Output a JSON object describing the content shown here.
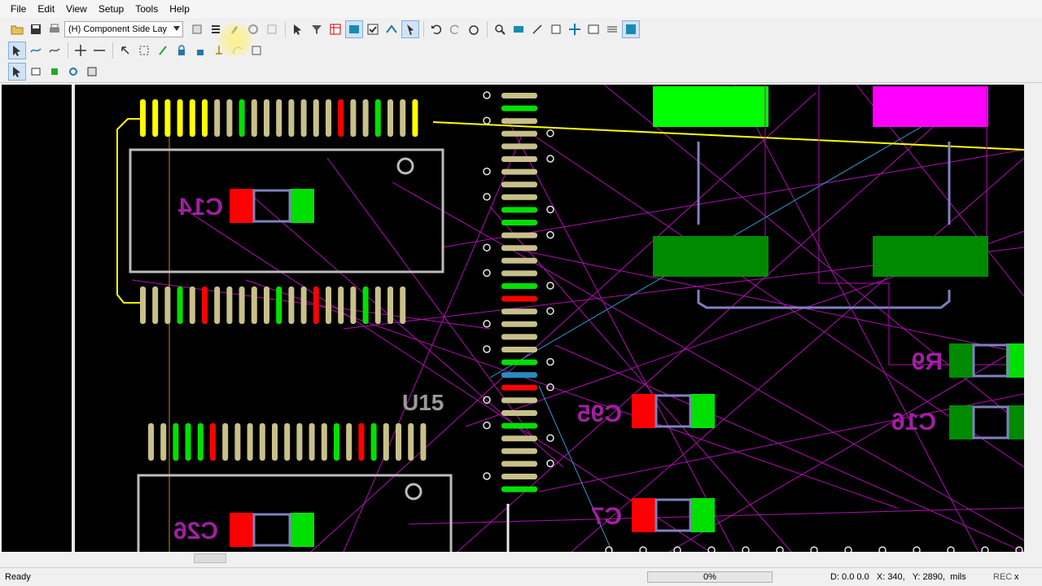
{
  "menu": {
    "file": "File",
    "edit": "Edit",
    "view": "View",
    "setup": "Setup",
    "tools": "Tools",
    "help": "Help"
  },
  "toolbar": {
    "layer_value": "(H) Component Side Lay"
  },
  "pcb": {
    "labels": {
      "c14": "C14",
      "u15": "U15",
      "c95": "C95",
      "c7": "C7",
      "c16": "C16",
      "r9": "R9",
      "c26": "C26"
    },
    "colors": {
      "background": "#000000",
      "ratsnest": "#b010b0",
      "trace_selected": "#ffff00",
      "pad": "#c8c08a",
      "pad_green": "#00e000",
      "pad_red": "#ff0000",
      "outline": "#bcbcbc",
      "label_magenta": "#a020a0",
      "label_gray": "#9a9a9a"
    }
  },
  "status": {
    "ready": "Ready",
    "progress": "0%",
    "coords": "D: 0.0 0.0   X: 340,   Y: 2890,  mils",
    "rec": "REC",
    "close": "x"
  }
}
